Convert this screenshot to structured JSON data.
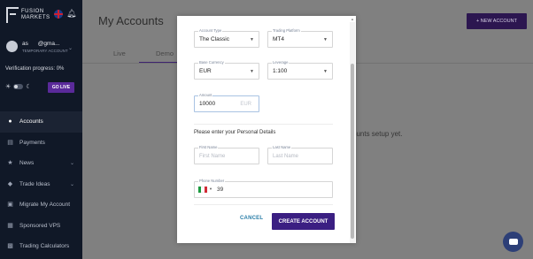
{
  "sidebar": {
    "logo_text_1": "FUSION",
    "logo_text_2": "MARKETS",
    "user_name": "as",
    "user_email": "@gma...",
    "user_sub": "TEMPORARY ACCOUNT",
    "verification": "Verification progress: 0%",
    "go_live": "GO LIVE",
    "items": [
      {
        "label": "Accounts",
        "icon": "user-icon",
        "glyph": "●",
        "active": true
      },
      {
        "label": "Payments",
        "icon": "card-icon",
        "glyph": "▤"
      },
      {
        "label": "News",
        "icon": "star-icon",
        "glyph": "★",
        "chevron": true
      },
      {
        "label": "Trade Ideas",
        "icon": "bulb-icon",
        "glyph": "◆",
        "chevron": true
      },
      {
        "label": "Migrate My Account",
        "icon": "migrate-icon",
        "glyph": "▣"
      },
      {
        "label": "Sponsored VPS",
        "icon": "server-icon",
        "glyph": "▦"
      },
      {
        "label": "Trading Calculators",
        "icon": "calculator-icon",
        "glyph": "▩"
      }
    ]
  },
  "main": {
    "title": "My Accounts",
    "new_account": "+ NEW ACCOUNT",
    "tabs": [
      "Live",
      "Demo"
    ],
    "empty_text": "ounts setup yet."
  },
  "modal": {
    "account_type": {
      "label": "Account Type",
      "value": "The Classic"
    },
    "platform": {
      "label": "Trading Platform",
      "value": "MT4"
    },
    "currency": {
      "label": "Base Currency",
      "value": "EUR"
    },
    "leverage": {
      "label": "Leverage",
      "value": "1:100"
    },
    "amount": {
      "label": "Amount",
      "value": "10000",
      "suffix": "EUR"
    },
    "personal_title": "Please enter your Personal Details",
    "first_name": {
      "label": "First Name",
      "placeholder": "First Name"
    },
    "last_name": {
      "label": "Last Name",
      "placeholder": "Last Name"
    },
    "phone": {
      "label": "Phone Number",
      "value": "39"
    },
    "cancel": "CANCEL",
    "create": "CREATE ACCOUNT"
  },
  "colors": {
    "sidebar_bg": "#101827",
    "brand_purple": "#3b1f82",
    "link_blue": "#2a7ea8",
    "overlay_bg": "#808080"
  }
}
